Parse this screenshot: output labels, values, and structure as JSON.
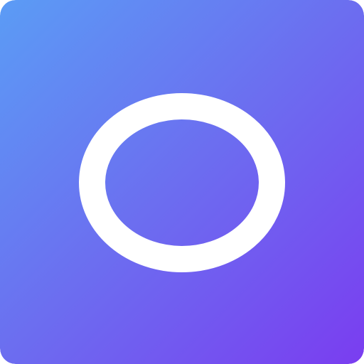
{
  "icon": {
    "name": "o-letter-icon",
    "letter": "O",
    "colors": {
      "gradient_start": "#5b9cf5",
      "gradient_mid": "#6c6df0",
      "gradient_end": "#7a3df0",
      "glyph": "#ffffff"
    }
  }
}
